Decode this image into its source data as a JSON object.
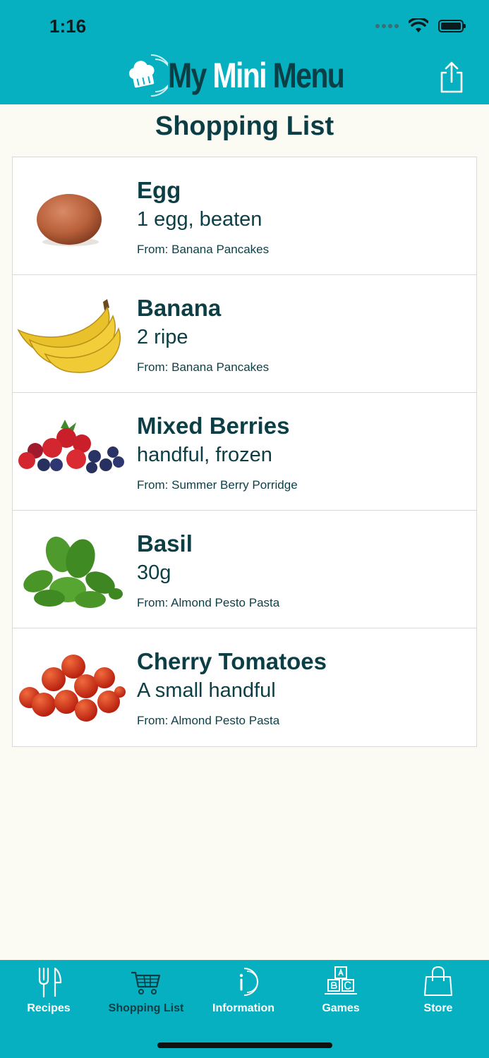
{
  "status_bar": {
    "time": "1:16"
  },
  "header": {
    "logo": {
      "my": "My",
      "mini": "Mini",
      "menu": "Menu"
    },
    "share_icon": "share-icon"
  },
  "page": {
    "title": "Shopping List"
  },
  "items": [
    {
      "name": "Egg",
      "quantity": "1 egg, beaten",
      "from": "From: Banana Pancakes",
      "image": "egg"
    },
    {
      "name": "Banana",
      "quantity": "2 ripe",
      "from": "From: Banana Pancakes",
      "image": "banana"
    },
    {
      "name": "Mixed Berries",
      "quantity": "handful, frozen",
      "from": "From: Summer Berry Porridge",
      "image": "mixed-berries"
    },
    {
      "name": "Basil",
      "quantity": "30g",
      "from": "From: Almond Pesto Pasta",
      "image": "basil"
    },
    {
      "name": "Cherry Tomatoes",
      "quantity": "A small handful",
      "from": "From: Almond Pesto Pasta",
      "image": "cherry-tomatoes"
    }
  ],
  "tabbar": {
    "tabs": [
      {
        "label": "Recipes",
        "icon": "fork-knife-icon"
      },
      {
        "label": "Shopping List",
        "icon": "shopping-cart-icon",
        "active": true
      },
      {
        "label": "Information",
        "icon": "info-icon"
      },
      {
        "label": "Games",
        "icon": "abc-blocks-icon"
      },
      {
        "label": "Store",
        "icon": "shopping-bag-icon"
      }
    ]
  },
  "colors": {
    "brand_teal": "#07b0c0",
    "dark_teal": "#0c3f45",
    "background": "#fcfbf3"
  }
}
